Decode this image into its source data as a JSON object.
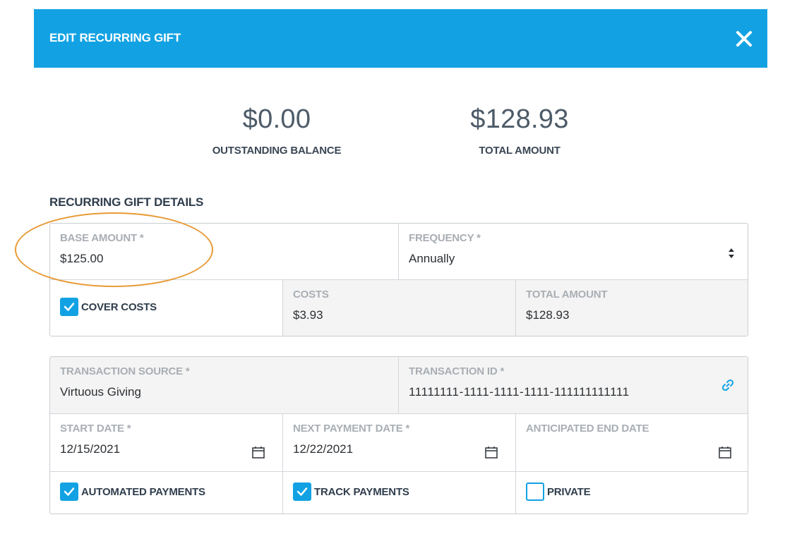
{
  "header": {
    "title": "EDIT RECURRING GIFT",
    "close_icon": "close-icon"
  },
  "summary": {
    "outstanding": {
      "amount": "$0.00",
      "label": "OUTSTANDING BALANCE"
    },
    "total": {
      "amount": "$128.93",
      "label": "TOTAL AMOUNT"
    }
  },
  "details": {
    "title": "RECURRING GIFT DETAILS",
    "base_amount": {
      "label": "BASE AMOUNT  *",
      "value": "$125.00"
    },
    "frequency": {
      "label": "FREQUENCY *",
      "value": "Annually"
    },
    "cover_costs": {
      "label": "COVER COSTS",
      "checked": true
    },
    "costs": {
      "label": "COSTS",
      "value": "$3.93"
    },
    "total_amount": {
      "label": "TOTAL AMOUNT",
      "value": "$128.93"
    }
  },
  "transaction": {
    "source": {
      "label": "TRANSACTION SOURCE *",
      "value": "Virtuous Giving"
    },
    "id": {
      "label": "TRANSACTION ID *",
      "value": "11111111-1111-1111-1111-111111111111",
      "icon": "link-icon"
    },
    "start_date": {
      "label": "START DATE *",
      "value": "12/15/2021"
    },
    "next_payment_date": {
      "label": "NEXT PAYMENT DATE *",
      "value": "12/22/2021"
    },
    "anticipated_end_date": {
      "label": "ANTICIPATED END DATE",
      "value": ""
    },
    "automated_payments": {
      "label": "AUTOMATED PAYMENTS",
      "checked": true
    },
    "track_payments": {
      "label": "TRACK PAYMENTS",
      "checked": true
    },
    "private": {
      "label": "PRIVATE",
      "checked": false
    }
  },
  "colors": {
    "header": "#12a2e3",
    "annotation": "#e89a35"
  }
}
